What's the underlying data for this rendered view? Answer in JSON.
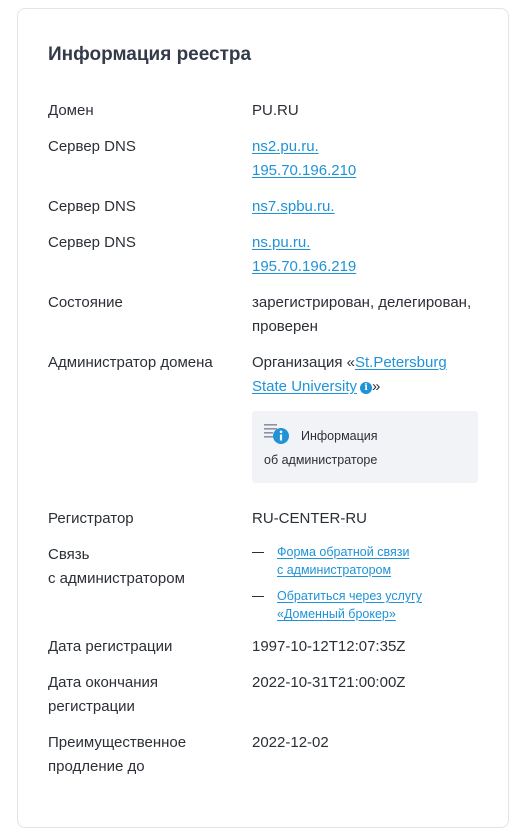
{
  "title": "Информация реестра",
  "rows": {
    "domain": {
      "label": "Домен",
      "value": "PU.RU"
    },
    "dns1": {
      "label": "Сервер DNS",
      "host": "ns2.pu.ru.",
      "ip": "195.70.196.210"
    },
    "dns2": {
      "label": "Сервер DNS",
      "host": "ns7.spbu.ru."
    },
    "dns3": {
      "label": "Сервер DNS",
      "host": "ns.pu.ru.",
      "ip": "195.70.196.219"
    },
    "state": {
      "label": "Состояние",
      "line1": "зарегистрирован, делегирован,",
      "line2": "проверен"
    },
    "admin": {
      "label": "Администратор домена",
      "prefix": "Организация «",
      "org_line1": "St.Petersburg",
      "org_line2": "State University",
      "suffix": "»",
      "info_glyph": "i",
      "box_line1": "Информация",
      "box_line2": "об администраторе"
    },
    "registrar": {
      "label": "Регистратор",
      "value": "RU-CENTER-RU"
    },
    "contact": {
      "label_line1": "Связь",
      "label_line2": "с администратором",
      "links": [
        {
          "line1": "Форма обратной связи",
          "line2": "с администратором"
        },
        {
          "line1": "Обратиться через услугу",
          "line2": "«Доменный брокер»"
        }
      ]
    },
    "reg_date": {
      "label": "Дата регистрации",
      "value": "1997-10-12T12:07:35Z"
    },
    "exp_date": {
      "label_line1": "Дата окончания",
      "label_line2": "регистрации",
      "value": "2022-10-31T21:00:00Z"
    },
    "renewal": {
      "label_line1": "Преимущественное",
      "label_line2": "продление до",
      "value": "2022-12-02"
    }
  },
  "colors": {
    "link": "#1f93d6",
    "box_bg": "#f2f3f6",
    "title": "#333b4a"
  },
  "icons": {
    "info": "info-icon",
    "admin_box": "document-info-icon"
  }
}
